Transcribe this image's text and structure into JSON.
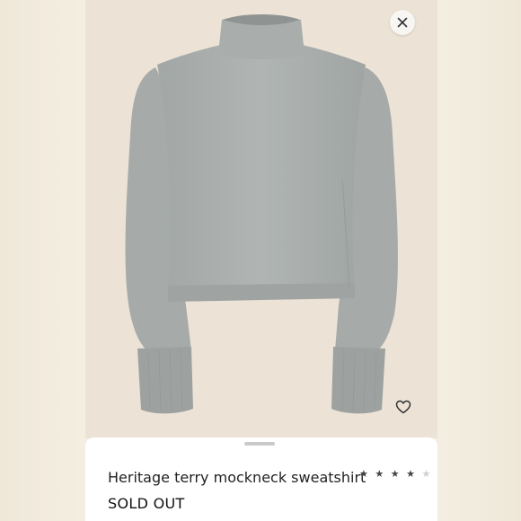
{
  "product": {
    "title": "Heritage terry mockneck sweatshirt",
    "status": "SOLD OUT",
    "rating": {
      "stars": [
        "★",
        "★",
        "★",
        "★",
        "★"
      ],
      "filled": 4,
      "out_of": 5
    },
    "image_subject": "gray mockneck sweatshirt"
  },
  "icons": {
    "close": "close-icon",
    "favorite": "heart-icon"
  },
  "colors": {
    "background": "#ece3d6",
    "garment": "#a8adab",
    "sheet": "#ffffff"
  }
}
